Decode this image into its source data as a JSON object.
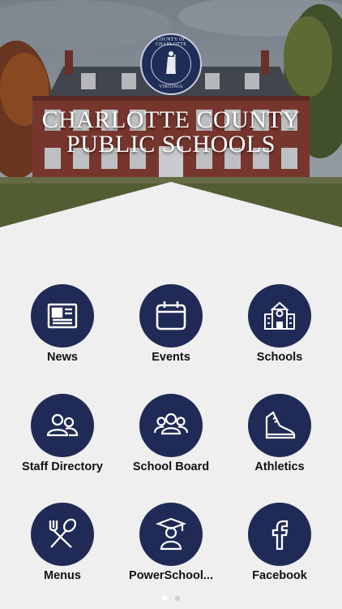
{
  "header": {
    "title_line1": "CHARLOTTE COUNTY",
    "title_line2": "PUBLIC SCHOOLS",
    "seal_text_top": "COUNTY OF CHARLOTTE",
    "seal_text_bottom": "VIRGINIA"
  },
  "tiles": [
    {
      "label": "News",
      "icon": "newspaper-icon"
    },
    {
      "label": "Events",
      "icon": "calendar-icon"
    },
    {
      "label": "Schools",
      "icon": "school-building-icon"
    },
    {
      "label": "Staff Directory",
      "icon": "people-icon"
    },
    {
      "label": "School Board",
      "icon": "group-icon"
    },
    {
      "label": "Athletics",
      "icon": "sneaker-icon"
    },
    {
      "label": "Menus",
      "icon": "fork-spoon-icon"
    },
    {
      "label": "PowerSchool...",
      "icon": "graduate-icon"
    },
    {
      "label": "Facebook",
      "icon": "facebook-icon"
    }
  ],
  "pager": {
    "pages": 2,
    "current": 1
  },
  "colors": {
    "accent": "#1f2a56",
    "background": "#efefef",
    "dot_active": "#ffffff",
    "dot_inactive": "#cfcfcf"
  }
}
